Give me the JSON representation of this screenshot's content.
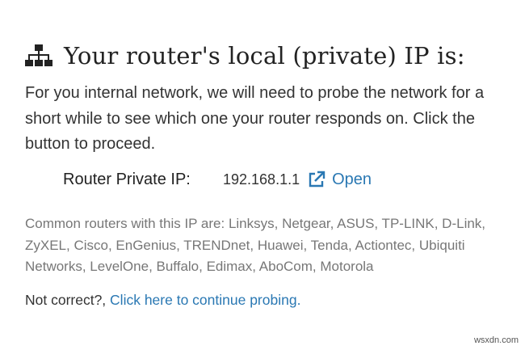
{
  "heading": {
    "icon": "sitemap-icon",
    "title": "Your router's local (private) IP is:"
  },
  "intro": {
    "text": "For you internal network, we will need to probe the network for a short while to see which one your router responds on. Click the button to proceed."
  },
  "router": {
    "label": "Router Private IP:",
    "ip": "192.168.1.1",
    "open_icon": "external-link-icon",
    "open_label": "Open"
  },
  "common_routers": {
    "text": "Common routers with this IP are: Linksys, Netgear, ASUS, TP-LINK, D-Link, ZyXEL, Cisco, EnGenius, TRENDnet, Huawei, Tenda, Actiontec, Ubiquiti Networks, LevelOne, Buffalo, Edimax, AboCom, Motorola"
  },
  "not_correct": {
    "prefix": "Not correct?, ",
    "link": "Click here to continue probing."
  },
  "watermark": "wsxdn.com",
  "colors": {
    "link": "#2a78b3",
    "text": "#333333",
    "muted": "#777777"
  }
}
